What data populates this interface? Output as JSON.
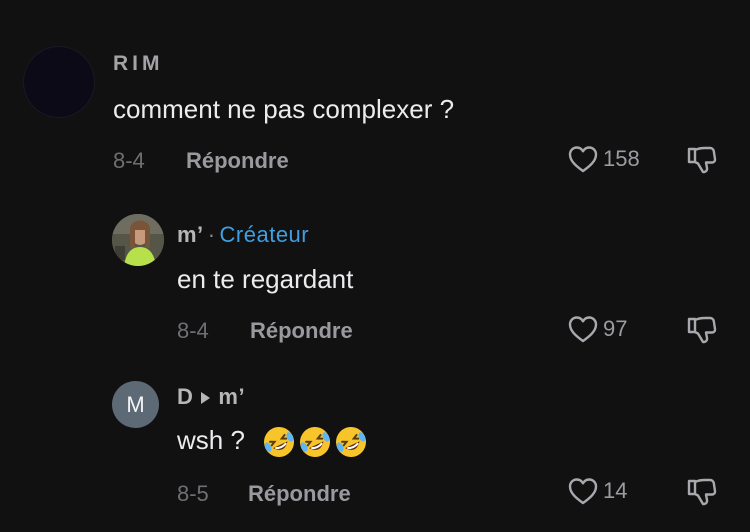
{
  "comments": [
    {
      "author": "RIM",
      "text": "comment ne pas complexer ?",
      "date": "8-4",
      "reply_label": "Répondre",
      "likes": "158"
    },
    {
      "author": "m’",
      "separator": "·",
      "creator_label": "Créateur",
      "text": "en te regardant",
      "date": "8-4",
      "reply_label": "Répondre",
      "likes": "97"
    },
    {
      "author": "D",
      "reply_to": "m’",
      "avatar_initial": "M",
      "text": "wsh ?",
      "emoji": [
        "rolling-on-floor-laughing",
        "rolling-on-floor-laughing",
        "rolling-on-floor-laughing"
      ],
      "date": "8-5",
      "reply_label": "Répondre",
      "likes": "14"
    }
  ],
  "colors": {
    "background": "#111112",
    "creator_accent": "#3f9fe0",
    "text_primary": "#ececee",
    "text_muted": "#6f6f73"
  }
}
